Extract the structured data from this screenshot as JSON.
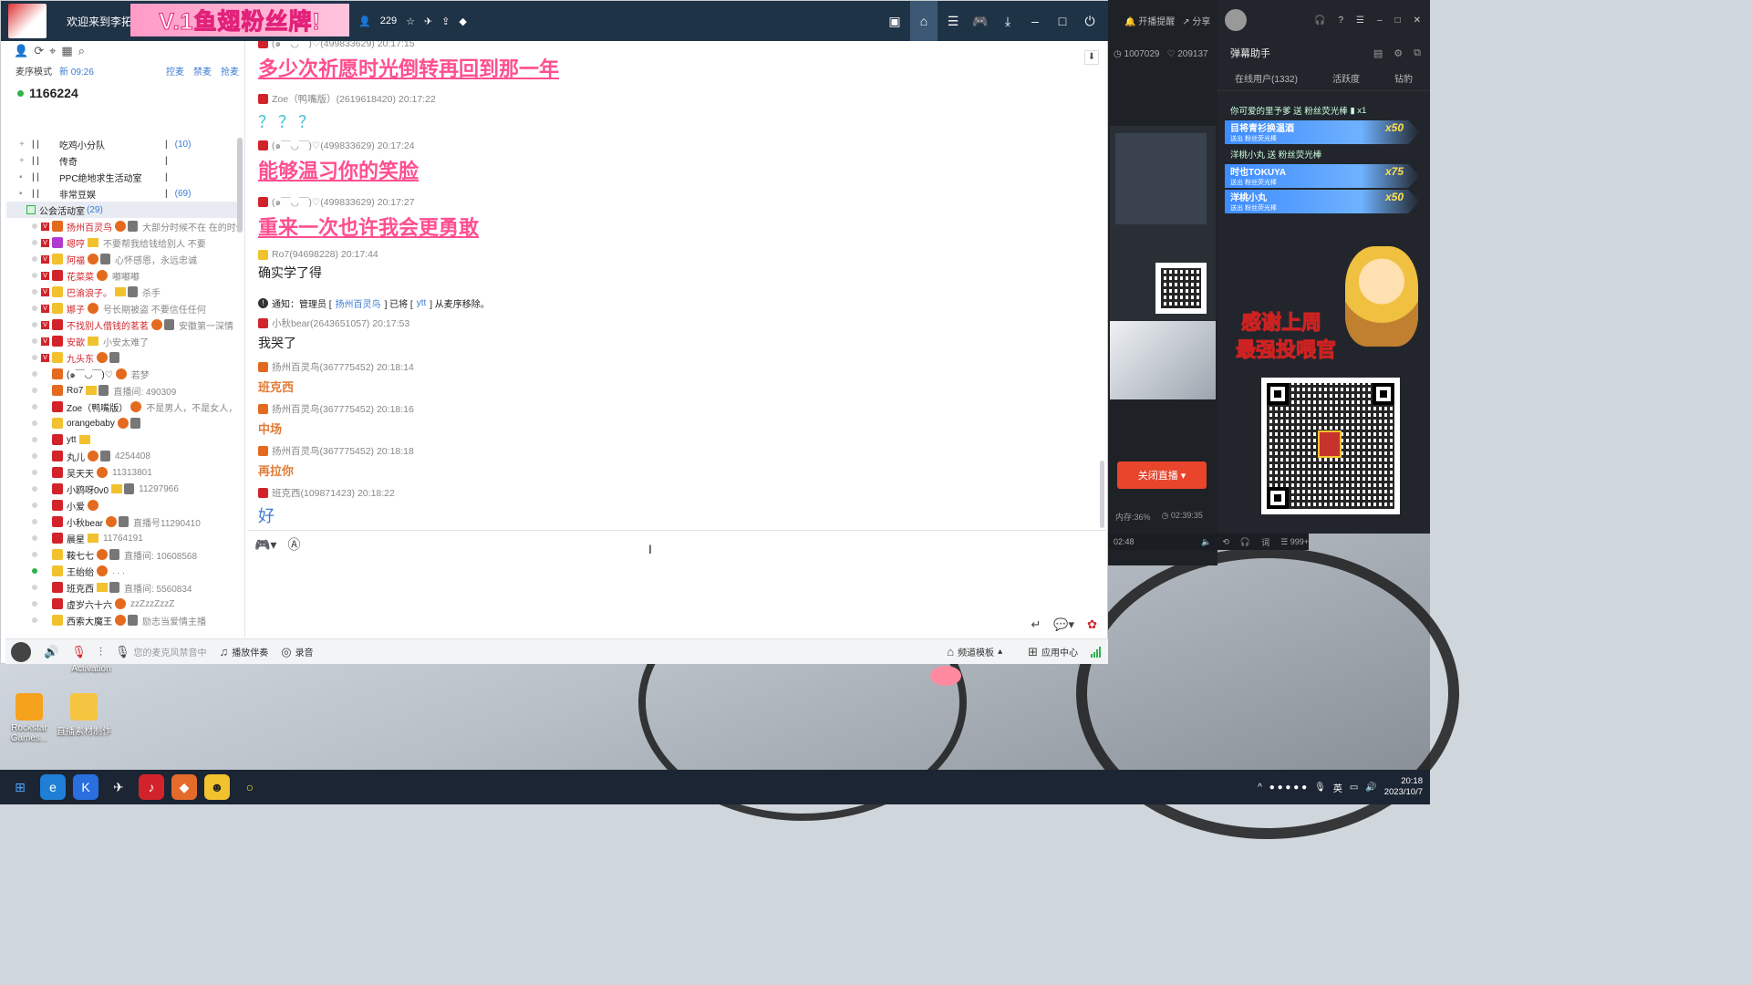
{
  "titlebar": {
    "welcome": "欢迎来到李拓新",
    "banner": "V.1鱼翅粉丝牌!",
    "user_count": "229"
  },
  "left_panel": {
    "mode_label": "麦序模式",
    "mode_time": "新 09:26",
    "grab_links": [
      "控麦",
      "禁麦",
      "抢麦"
    ],
    "channel_id": "1166224",
    "channels": [
      {
        "name": "吃鸡小分队",
        "count": "(10)"
      },
      {
        "name": "传奇",
        "count": ""
      },
      {
        "name": "PPC绝地求生活动室",
        "count": ""
      },
      {
        "name": "非常豆娱",
        "count": "(69)"
      }
    ],
    "current_channel": {
      "name": "公会活动室",
      "count": "(29)"
    },
    "users": [
      {
        "name": "扬州百灵鸟",
        "sign": "大部分时候不在 在的时候",
        "v": true,
        "color": "#e36a1e",
        "red": true
      },
      {
        "name": "嗯哼",
        "sign": "不要帮我给钱给别人 不要",
        "v": true,
        "color": "#b13bd2",
        "red": true
      },
      {
        "name": "阿福",
        "sign": "心怀感恩，永远忠诚",
        "v": true,
        "color": "#f2c12e",
        "red": true
      },
      {
        "name": "花菜菜",
        "sign": "嘟嘟嘟",
        "v": true,
        "color": "#d2232a",
        "red": true
      },
      {
        "name": "巴渝浪子。",
        "sign": "杀手",
        "v": true,
        "color": "#f2c12e",
        "red": true
      },
      {
        "name": "娜子",
        "sign": "号长期被盗 不要信任任何",
        "v": true,
        "color": "#f2c12e",
        "red": true
      },
      {
        "name": "不找别人借钱的茗茗",
        "sign": "安徽第一深情",
        "v": true,
        "color": "#d2232a",
        "red": true
      },
      {
        "name": "安歆",
        "sign": "小安太难了",
        "v": true,
        "color": "#d2232a",
        "red": true
      },
      {
        "name": "九头东",
        "sign": "",
        "v": true,
        "color": "#f2c12e",
        "red": true
      },
      {
        "name": "(๑￣◡￣)♡",
        "sign": "若梦",
        "v": false,
        "color": "#e36a1e",
        "red": false
      },
      {
        "name": "Ro7",
        "sign": "直播间: 490309",
        "v": false,
        "color": "#e36a1e",
        "red": false
      },
      {
        "name": "Zoe（鸭嘴版）",
        "sign": "不是男人，不是女人，",
        "v": false,
        "color": "#d2232a",
        "red": false
      },
      {
        "name": "orangebaby",
        "sign": "",
        "v": false,
        "color": "#f2c12e",
        "red": false
      },
      {
        "name": "ytt",
        "sign": "",
        "v": false,
        "color": "#d2232a",
        "red": false
      },
      {
        "name": "丸儿",
        "sign": "4254408",
        "v": false,
        "color": "#d2232a",
        "red": false
      },
      {
        "name": "吴天天",
        "sign": "11313801",
        "v": false,
        "color": "#d2232a",
        "red": false
      },
      {
        "name": "小鸥呀0v0",
        "sign": "11297966",
        "v": false,
        "color": "#d2232a",
        "red": false
      },
      {
        "name": "小爱",
        "sign": "",
        "v": false,
        "color": "#d2232a",
        "red": false
      },
      {
        "name": "小秋bear",
        "sign": "直播号11290410",
        "v": false,
        "color": "#d2232a",
        "red": false
      },
      {
        "name": "晨星",
        "sign": "11764191",
        "v": false,
        "color": "#d2232a",
        "red": false
      },
      {
        "name": "鞍七七",
        "sign": "直播间: 10608568",
        "v": false,
        "color": "#f2c12e",
        "red": false
      },
      {
        "name": "王绐绐",
        "sign": ". . .",
        "v": false,
        "color": "#f2c12e",
        "red": false,
        "online": true
      },
      {
        "name": "班克西",
        "sign": "直播间: 5560834",
        "v": false,
        "color": "#d2232a",
        "red": false
      },
      {
        "name": "虚岁六十六",
        "sign": "zzZzzZzzZ",
        "v": false,
        "color": "#d2232a",
        "red": false
      },
      {
        "name": "西索大魔王",
        "sign": "励志当爱情主播",
        "v": false,
        "color": "#f2c12e",
        "red": false
      }
    ]
  },
  "chat": {
    "messages": [
      {
        "type": "big",
        "head": "(๑￣◡￣)♡(499833629) 20:17:15",
        "text": "多少次祈愿时光倒转再回到那一年"
      },
      {
        "type": "cyan",
        "head": "Zoe（鸭嘴版）(2619618420)  20:17:22",
        "text": "？？？"
      },
      {
        "type": "big",
        "head": "(๑￣◡￣)♡(499833629)  20:17:24",
        "text": "能够温习你的笑脸"
      },
      {
        "type": "big",
        "head": "(๑￣◡￣)♡(499833629)  20:17:27",
        "text": "重来一次也许我会更勇敢"
      },
      {
        "type": "plain",
        "head": "Ro7(94698228)  20:17:44",
        "text": "确实学了得"
      },
      {
        "type": "notice",
        "prefix": "通知：管理员 [",
        "admin": "扬州百灵鸟",
        "mid": "] 已将 [",
        "target": "ytt",
        "suffix": "] 从麦序移除。"
      },
      {
        "type": "plain",
        "head": "小秋bear(2643651057)  20:17:53",
        "text": "我哭了"
      },
      {
        "type": "orange",
        "head": "扬州百灵鸟(367775452)  20:18:14",
        "text": "班克西"
      },
      {
        "type": "orange",
        "head": "扬州百灵鸟(367775452)  20:18:16",
        "text": "中场"
      },
      {
        "type": "orange",
        "head": "扬州百灵鸟(367775452)  20:18:18",
        "text": "再拉你"
      },
      {
        "type": "blue",
        "head": "班克西(109871423)  20:18:22",
        "text": "好"
      }
    ]
  },
  "bottom_bar": {
    "mic_banned": "您的麦克风禁音中",
    "accompany": "播放伴奏",
    "record": "录音",
    "template": "频道模板",
    "app_center": "应用中心"
  },
  "stream_panel": {
    "remind": "开播提醒",
    "share": "分享",
    "viewers": "1007029",
    "likes": "209137",
    "close_live": "关闭直播",
    "memory": "内存:36%",
    "duration": "02:39:35"
  },
  "danmu": {
    "title": "弹幕助手",
    "tabs": [
      "在线用户(1332)",
      "活跃度",
      "钻豹"
    ],
    "gift_line1": "你可爱的里予爹 送 粉丝荧光棒",
    "gift_bars": [
      {
        "name": "目将青衫换温酒",
        "sub": "送出  粉丝荧光棒",
        "mult": "x50"
      },
      {
        "name": "时也TOKUYA",
        "sub": "送出  粉丝荧光棒",
        "mult": "x75"
      },
      {
        "name": "洋桃小丸",
        "sub": "送出  粉丝荧光棒",
        "mult": "x50"
      }
    ],
    "gift_line2": "洋桃小丸 送 粉丝荧光棒",
    "overlay_text1": "感谢上周",
    "overlay_text2": "最强投喂官",
    "bottom_time": "02:48",
    "bottom_count": "999+"
  },
  "taskbar": {
    "ime": "英",
    "time": "20:18",
    "date": "2023/10/7"
  },
  "desktop": {
    "icon1": "Rockstar Games...",
    "icon2": "直播素材制作",
    "activation": "Activation"
  }
}
